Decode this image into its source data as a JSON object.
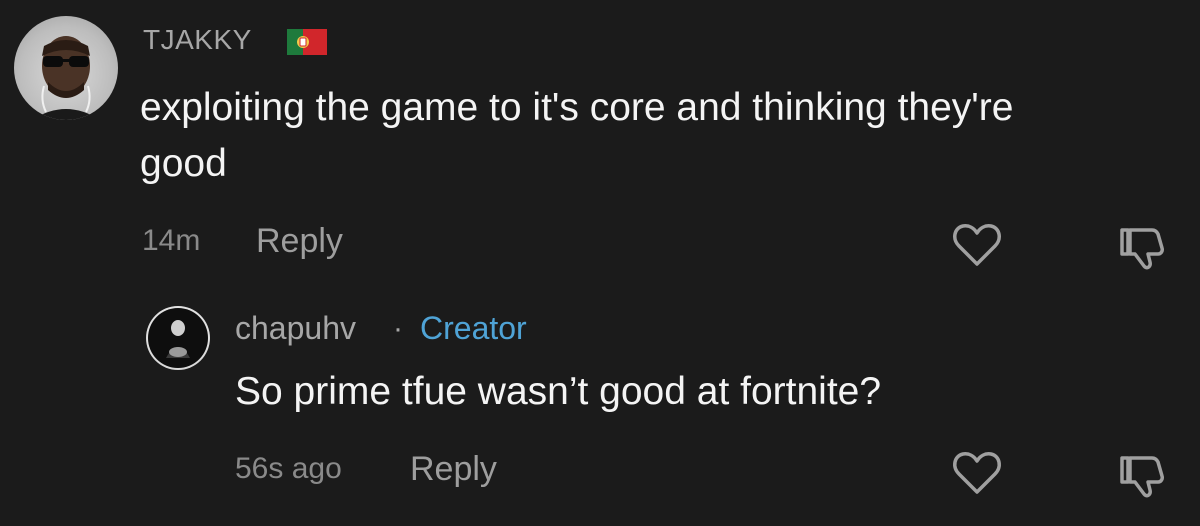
{
  "comment": {
    "username": "TJAKKY",
    "flag_icon": "portugal-flag-icon",
    "text": "exploiting the game to it's core and thinking they're good",
    "timestamp": "14m",
    "reply_label": "Reply",
    "avatar_icon": "user-avatar"
  },
  "reply": {
    "username": "chapuhv",
    "separator": "·",
    "badge": "Creator",
    "text": "So prime tfue wasn’t good at fortnite?",
    "timestamp": "56s ago",
    "reply_label": "Reply",
    "avatar_icon": "user-avatar"
  },
  "icons": {
    "like": "heart-icon",
    "dislike": "thumbs-down-icon"
  },
  "colors": {
    "background": "#1b1b1b",
    "username": "#a7a7a7",
    "creator_badge": "#4fa3d6",
    "text": "#f4f4f4",
    "meta": "#8a8a8a"
  }
}
